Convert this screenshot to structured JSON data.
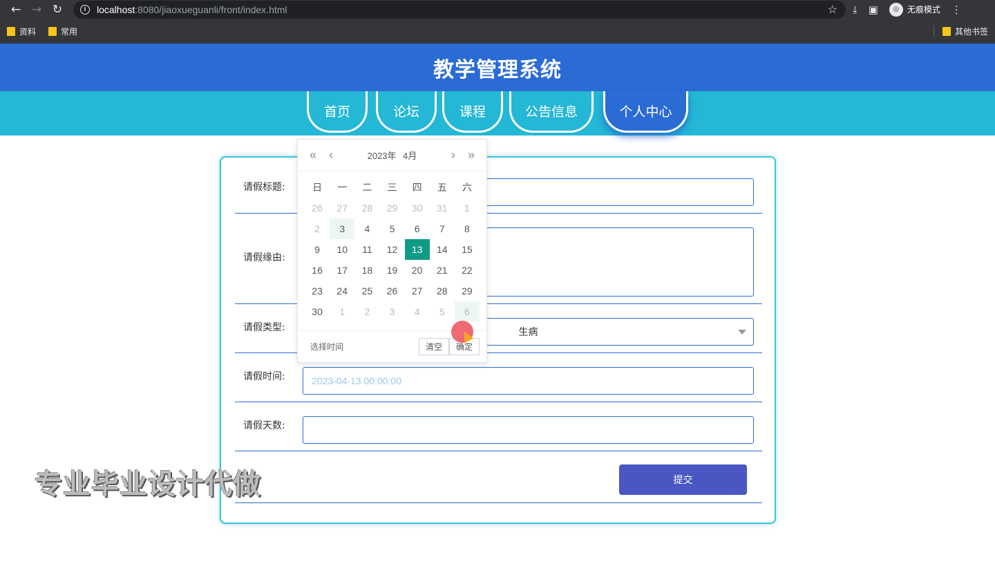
{
  "browser": {
    "url_host": "localhost",
    "url_rest": ":8080/jiaoxueguanli/front/index.html",
    "incognito_label": "无痕模式",
    "bookmarks": [
      "资料",
      "常用"
    ],
    "bookmarks_right": "其他书签"
  },
  "site": {
    "title": "教学管理系统"
  },
  "nav": {
    "items": [
      "首页",
      "论坛",
      "课程",
      "公告信息",
      "个人中心"
    ],
    "active": "个人中心"
  },
  "form": {
    "title_label": "请假标题:",
    "reason_label": "请假缘由:",
    "type_label": "请假类型:",
    "type_value": "生病",
    "time_label": "请假时间:",
    "time_placeholder": "2023-04-13 00:00:00",
    "days_label": "请假天数:",
    "submit_label": "提交"
  },
  "datepicker": {
    "year_month": "2023年 4月",
    "weekdays": [
      "日",
      "一",
      "二",
      "三",
      "四",
      "五",
      "六"
    ],
    "weeks": [
      [
        "26",
        "27",
        "28",
        "29",
        "30",
        "31",
        "1"
      ],
      [
        "2",
        "3",
        "4",
        "5",
        "6",
        "7",
        "8"
      ],
      [
        "9",
        "10",
        "11",
        "12",
        "13",
        "14",
        "15"
      ],
      [
        "16",
        "17",
        "18",
        "19",
        "20",
        "21",
        "22"
      ],
      [
        "23",
        "24",
        "25",
        "26",
        "27",
        "28",
        "29"
      ],
      [
        "30",
        "1",
        "2",
        "3",
        "4",
        "5",
        "6"
      ]
    ],
    "other_month_mask": [
      [
        1,
        1,
        1,
        1,
        1,
        1,
        1
      ],
      [
        1,
        0,
        0,
        0,
        0,
        0,
        0
      ],
      [
        0,
        0,
        0,
        0,
        0,
        0,
        0
      ],
      [
        0,
        0,
        0,
        0,
        0,
        0,
        0
      ],
      [
        0,
        0,
        0,
        0,
        0,
        0,
        0
      ],
      [
        0,
        1,
        1,
        1,
        1,
        1,
        1
      ]
    ],
    "selected_day": "13",
    "highlighted_day": "3",
    "select_time_label": "选择时间",
    "clear_label": "清空",
    "confirm_label": "确定"
  },
  "watermark": "专业毕业设计代做",
  "colors": {
    "header": "#2a6bd4",
    "nav_band": "#24b7d6",
    "selected_day": "#0f9b87",
    "submit": "#4a56c2"
  }
}
